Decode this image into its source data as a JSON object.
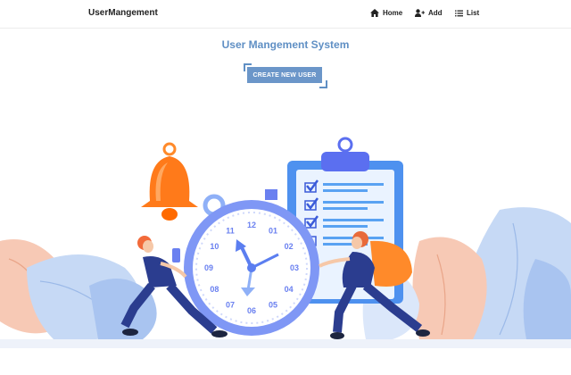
{
  "navbar": {
    "brand": "UserMangement",
    "items": [
      {
        "label": "Home",
        "icon": "home-icon"
      },
      {
        "label": "Add",
        "icon": "add-user-icon"
      },
      {
        "label": "List",
        "icon": "list-icon"
      }
    ]
  },
  "main": {
    "title": "User Mangement System",
    "cta_label": "CREATE NEW USER"
  },
  "illustration": {
    "clock_numbers": [
      "12",
      "01",
      "02",
      "03",
      "04",
      "05",
      "06",
      "07",
      "08",
      "09",
      "10",
      "11"
    ]
  },
  "colors": {
    "accent": "#5f8fc4",
    "button": "#6b96c9",
    "bell": "#ff7a1a",
    "clock": "#6a80f0",
    "clipboard": "#3d7de6"
  }
}
